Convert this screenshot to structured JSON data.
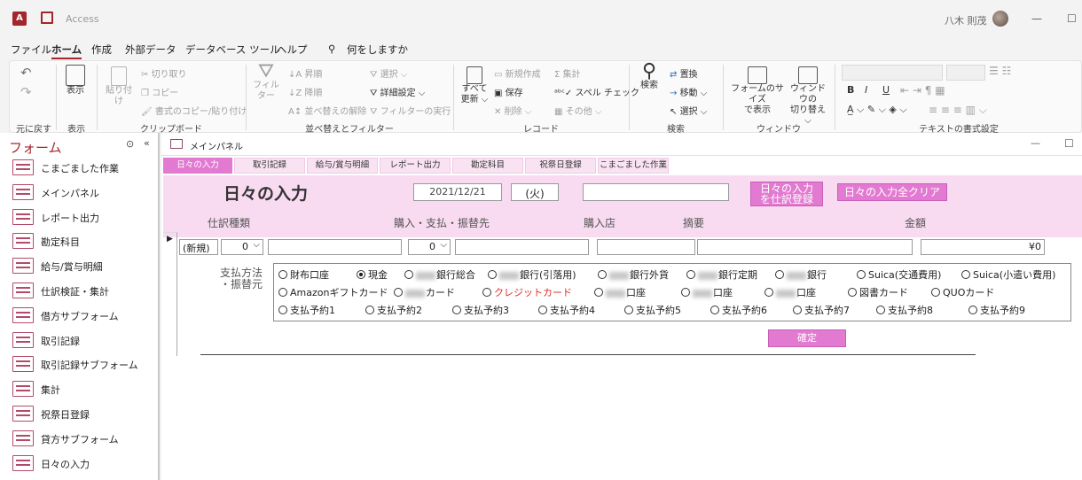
{
  "title_bar": {
    "app_title": "Access",
    "user_name": "八木 則茂"
  },
  "menu": {
    "items": [
      "ファイル",
      "ホーム",
      "作成",
      "外部データ",
      "データベース ツール",
      "ヘルプ"
    ],
    "search_text": "何をしますか"
  },
  "ribbon": {
    "undo": {
      "group": "元に戻す"
    },
    "view": {
      "label": "表示",
      "group": "表示"
    },
    "clipboard": {
      "paste": "貼り付け",
      "cut": "切り取り",
      "copy": "コピー",
      "format_paint": "書式のコピー/貼り付け",
      "group": "クリップボード"
    },
    "sort": {
      "filter": "フィルター",
      "asc": "昇順",
      "desc": "降順",
      "clear": "並べ替えの解除",
      "select": "選択",
      "advanced": "詳細設定",
      "toggle": "フィルターの実行",
      "group": "並べ替えとフィルター"
    },
    "records": {
      "refresh": "すべて",
      "refresh2": "更新",
      "new": "新規作成",
      "save": "保存",
      "delete": "削除",
      "totals": "集計",
      "spelling": "スペル チェック",
      "more": "その他",
      "group": "レコード"
    },
    "find": {
      "find": "検索",
      "replace": "置換",
      "goto": "移動",
      "select": "選択",
      "group": "検索"
    },
    "window": {
      "fit1": "フォームのサイズ",
      "fit2": "で表示",
      "switch1": "ウィンドウの",
      "switch2": "切り替え",
      "group": "ウィンドウ"
    },
    "text_format": {
      "group": "テキストの書式設定"
    }
  },
  "nav": {
    "title": "フォーム",
    "items": [
      "こまごました作業",
      "メインパネル",
      "レポート出力",
      "勘定科目",
      "給与/賞与明細",
      "仕訳検証・集計",
      "借方サブフォーム",
      "取引記録",
      "取引記録サブフォーム",
      "集計",
      "祝祭日登録",
      "貸方サブフォーム",
      "日々の入力"
    ]
  },
  "form": {
    "window_title": "メインパネル",
    "tabs": [
      "日々の入力",
      "取引記録",
      "給与/賞与明細",
      "レポート出力",
      "勘定科目",
      "祝祭日登録",
      "こまごました作業"
    ],
    "heading": "日々の入力",
    "date": "2021/12/21",
    "weekday": "(火)",
    "register_btn1": "日々の入力",
    "register_btn2": "を仕訳登録",
    "clear_btn": "日々の入力全クリア",
    "columns": {
      "type": "仕訳種類",
      "purchase": "購入・支払・振替先",
      "store": "購入店",
      "summary": "摘要",
      "amount": "金額"
    },
    "row": {
      "status": "(新規)",
      "type_val": "0",
      "purchase_val": "0",
      "amount_val": "¥0"
    },
    "payment_label1": "支払方法",
    "payment_label2": "・振替元",
    "payment_options": {
      "r1": [
        "財布口座",
        "現金",
        "銀行総合",
        "銀行(引落用)",
        "銀行外貨",
        "銀行定期",
        "銀行",
        "Suica(交通費用)",
        "Suica(小遣い費用)"
      ],
      "r2": [
        "Amazonギフトカード",
        "カード",
        "クレジットカード",
        "口座",
        "口座",
        "口座",
        "図書カード",
        "QUOカード"
      ],
      "r3": [
        "支払予約1",
        "支払予約2",
        "支払予約3",
        "支払予約4",
        "支払予約5",
        "支払予約6",
        "支払予約7",
        "支払予約8",
        "支払予約9"
      ]
    },
    "confirm_btn": "確定"
  }
}
